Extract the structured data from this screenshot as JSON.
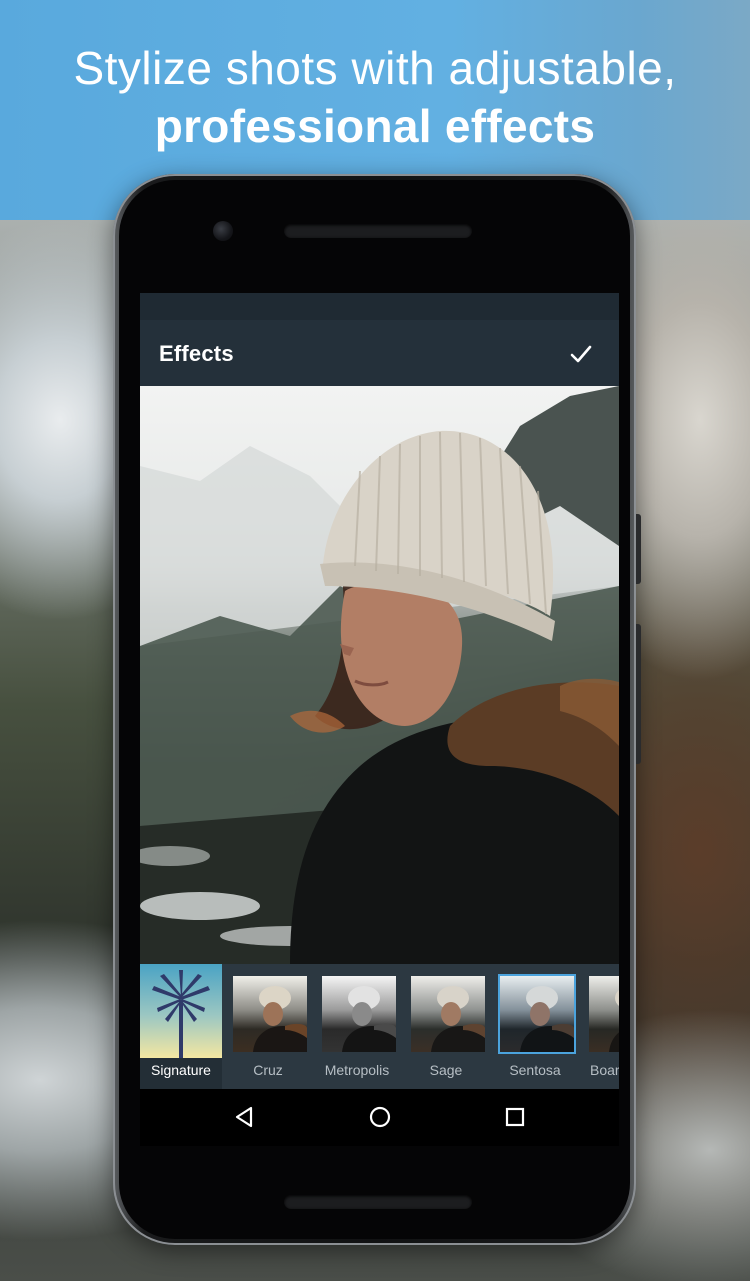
{
  "headline": {
    "line1": "Stylize shots with adjustable,",
    "line2": "professional effects"
  },
  "app": {
    "toolbar_title": "Effects",
    "confirm_icon": "check-icon"
  },
  "filters": [
    {
      "label": "Signature",
      "state": "active"
    },
    {
      "label": "Cruz"
    },
    {
      "label": "Metropolis"
    },
    {
      "label": "Sage"
    },
    {
      "label": "Sentosa",
      "state": "selected"
    },
    {
      "label": "Boar"
    }
  ],
  "navigation": {
    "icons": [
      "back-triangle-icon",
      "home-circle-icon",
      "recents-square-icon"
    ]
  },
  "colors": {
    "banner_blue": "#5faee0",
    "toolbar": "#24303a",
    "filter_strip": "#2c3841",
    "selection_accent": "#4ba3dd"
  }
}
